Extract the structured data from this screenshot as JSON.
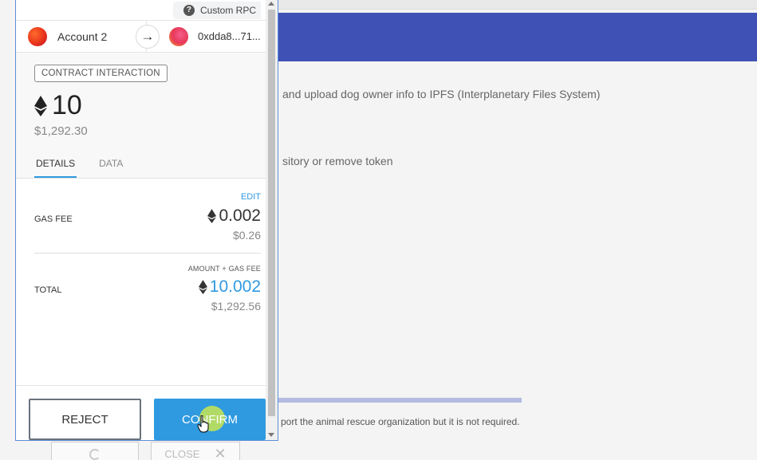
{
  "background": {
    "line1": "and upload dog owner info to IPFS (Interplanetary Files System)",
    "line2": "sitory or remove token",
    "note": "port the animal rescue organization but it is not required.",
    "close_label": "CLOSE",
    "header_color": "#3f51b5"
  },
  "popup": {
    "network": "Custom RPC",
    "from_account": "Account 2",
    "to_address": "0xdda8...71...",
    "action": "CONTRACT INTERACTION",
    "amount": "10",
    "amount_fiat": "$1,292.30",
    "tabs": [
      {
        "label": "DETAILS",
        "active": true
      },
      {
        "label": "DATA",
        "active": false
      }
    ],
    "edit_label": "EDIT",
    "gas_fee_label": "GAS FEE",
    "gas_fee_eth": "0.002",
    "gas_fee_fiat": "$0.26",
    "total_heading": "AMOUNT + GAS FEE",
    "total_label": "TOTAL",
    "total_eth": "10.002",
    "total_fiat": "$1,292.56",
    "reject_label": "REJECT",
    "confirm_label": "CONFIRM",
    "accent_color": "#2f9ae0"
  }
}
